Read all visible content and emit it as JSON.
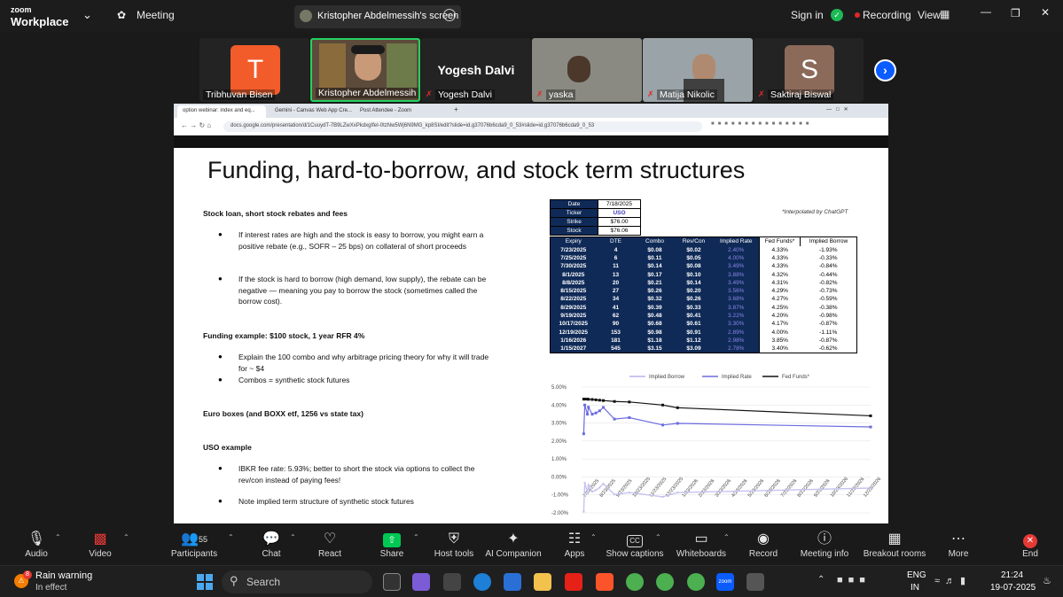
{
  "app": {
    "brand_top": "zoom",
    "brand_bottom": "Workplace",
    "meeting_label": "Meeting",
    "screen_share_title": "Kristopher Abdelmessih's screen",
    "sign_in": "Sign in",
    "recording": "Recording",
    "view": "View"
  },
  "colors": {
    "zoom_blue": "#0b5cff",
    "record_red": "#e02828",
    "share_green": "#00c853",
    "table_navy": "#0f2a57",
    "implied_rate": "#7a7ae0",
    "end_red": "#e53935"
  },
  "participants": [
    {
      "name": "Tribhuvan Bisen",
      "initial": "T",
      "color": "#f25c2a",
      "muted": false
    },
    {
      "name": "Kristopher Abdelmessih",
      "initial": "",
      "color": "",
      "muted": false,
      "active": true
    },
    {
      "name": "Yogesh Dalvi",
      "initial": "",
      "color": "",
      "muted": true
    },
    {
      "name": "yaska",
      "initial": "",
      "color": "",
      "muted": true
    },
    {
      "name": "Matija Nikolic",
      "initial": "",
      "color": "",
      "muted": true
    },
    {
      "name": "Saktiraj Biswal",
      "initial": "S",
      "color": "#8c6a5a",
      "muted": true
    }
  ],
  "yogesh_big": "Yogesh Dalvi",
  "browser": {
    "tabs": [
      "option webinar: index and eq...",
      "Gemini - Canvas Web App Cre...",
      "Post Attendee - Zoom"
    ],
    "url": "docs.google.com/presentation/d/1CuuydT-7B9LZwXxPkdxgIfeI-0tzNw5Wj6N9MG_kp8SI/edit?slide=id.g37076b6cda9_0_53#slide=id.g37076b6cda9_0_53"
  },
  "slide": {
    "title": "Funding, hard-to-borrow, and stock term structures",
    "sec1": "Stock loan, short stock rebates and fees",
    "b1": "If interest rates are high and the stock is easy to borrow, you might earn a positive rebate (e.g., SOFR – 25 bps) on collateral of short proceeds",
    "b2": "If the stock is hard to borrow (high demand, low supply), the rebate can be negative — meaning you pay to borrow the stock (sometimes called the borrow cost).",
    "sec2": "Funding example: $100 stock, 1 year RFR 4%",
    "b3": "Explain the 100 combo and why  arbitrage pricing theory for why it will trade for ~ $4",
    "b4": "Combos = synthetic stock futures",
    "sec3": "Euro boxes (and BOXX etf, 1256 vs state tax)",
    "sec4": "USO example",
    "b5": "IBKR fee rate: 5.93%; better to short the stock via options to collect the rev/con instead of paying fees!",
    "b6": "Note implied term structure of synthetic stock futures",
    "note": "*Interpolated by ChatGPT",
    "info": [
      [
        "Date",
        "7/18/2025"
      ],
      [
        "Ticker",
        "USO"
      ],
      [
        "Strike",
        "$76.00"
      ],
      [
        "Stock",
        "$76.06"
      ]
    ],
    "headers": [
      "Expiry",
      "DTE",
      "Combo",
      "Rev/Con",
      "Implied Rate",
      "Fed Funds*",
      "Implied Borrow"
    ],
    "rows": [
      [
        "7/23/2025",
        "4",
        "$0.08",
        "$0.02",
        "2.40%",
        "4.33%",
        "-1.93%"
      ],
      [
        "7/25/2025",
        "6",
        "$0.11",
        "$0.05",
        "4.00%",
        "4.33%",
        "-0.33%"
      ],
      [
        "7/30/2025",
        "11",
        "$0.14",
        "$0.08",
        "3.49%",
        "4.33%",
        "-0.84%"
      ],
      [
        "8/1/2025",
        "13",
        "$0.17",
        "$0.10",
        "3.88%",
        "4.32%",
        "-0.44%"
      ],
      [
        "8/8/2025",
        "20",
        "$0.21",
        "$0.14",
        "3.49%",
        "4.31%",
        "-0.82%"
      ],
      [
        "8/15/2025",
        "27",
        "$0.26",
        "$0.20",
        "3.56%",
        "4.29%",
        "-0.73%"
      ],
      [
        "8/22/2025",
        "34",
        "$0.32",
        "$0.26",
        "3.68%",
        "4.27%",
        "-0.59%"
      ],
      [
        "8/29/2025",
        "41",
        "$0.39",
        "$0.33",
        "3.87%",
        "4.25%",
        "-0.38%"
      ],
      [
        "9/19/2025",
        "62",
        "$0.48",
        "$0.41",
        "3.22%",
        "4.20%",
        "-0.98%"
      ],
      [
        "10/17/2025",
        "90",
        "$0.68",
        "$0.61",
        "3.30%",
        "4.17%",
        "-0.87%"
      ],
      [
        "12/19/2025",
        "153",
        "$0.98",
        "$0.91",
        "2.89%",
        "4.00%",
        "-1.11%"
      ],
      [
        "1/16/2026",
        "181",
        "$1.18",
        "$1.12",
        "2.98%",
        "3.85%",
        "-0.87%"
      ],
      [
        "1/15/2027",
        "545",
        "$3.15",
        "$3.09",
        "2.78%",
        "3.40%",
        "-0.62%"
      ]
    ]
  },
  "chart_data": {
    "type": "line",
    "legend": [
      "Implied Borrow",
      "Implied Rate",
      "Fed Funds*"
    ],
    "ylim": [
      -2,
      5
    ],
    "yticks": [
      "5.00%",
      "4.00%",
      "3.00%",
      "2.00%",
      "1.00%",
      "0.00%",
      "-1.00%",
      "-2.00%"
    ],
    "xticks": [
      "7/23/2025",
      "8/23/2025",
      "9/23/2025",
      "10/23/2025",
      "11/23/2025",
      "12/23/2025",
      "1/23/2026",
      "2/23/2026",
      "3/23/2026",
      "4/23/2026",
      "5/23/2026",
      "6/23/2026",
      "7/23/2026",
      "8/23/2026",
      "9/23/2026",
      "10/23/2026",
      "11/23/2026",
      "12/23/2026"
    ],
    "x_dte": [
      4,
      6,
      11,
      13,
      20,
      27,
      34,
      41,
      62,
      90,
      153,
      181,
      545
    ],
    "series": [
      {
        "name": "Implied Borrow",
        "values": [
          -1.93,
          -0.33,
          -0.84,
          -0.44,
          -0.82,
          -0.73,
          -0.59,
          -0.38,
          -0.98,
          -0.87,
          -1.11,
          -0.87,
          -0.62
        ]
      },
      {
        "name": "Implied Rate",
        "values": [
          2.4,
          4.0,
          3.49,
          3.88,
          3.49,
          3.56,
          3.68,
          3.87,
          3.22,
          3.3,
          2.89,
          2.98,
          2.78
        ]
      },
      {
        "name": "Fed Funds*",
        "values": [
          4.33,
          4.33,
          4.33,
          4.32,
          4.31,
          4.29,
          4.27,
          4.25,
          4.2,
          4.17,
          4.0,
          3.85,
          3.4
        ]
      }
    ]
  },
  "toolbar": {
    "audio": "Audio",
    "video": "Video",
    "participants": "Participants",
    "participants_count": "55",
    "chat": "Chat",
    "react": "React",
    "share": "Share",
    "host_tools": "Host tools",
    "ai_companion": "AI Companion",
    "apps": "Apps",
    "show_captions": "Show captions",
    "whiteboards": "Whiteboards",
    "record": "Record",
    "meeting_info": "Meeting info",
    "breakout_rooms": "Breakout rooms",
    "more": "More",
    "end": "End"
  },
  "taskbar": {
    "weather_title": "Rain warning",
    "weather_sub": "In effect",
    "weather_badge": "8",
    "search": "Search",
    "lang": "ENG",
    "region": "IN",
    "time": "21:24",
    "date": "19-07-2025"
  }
}
